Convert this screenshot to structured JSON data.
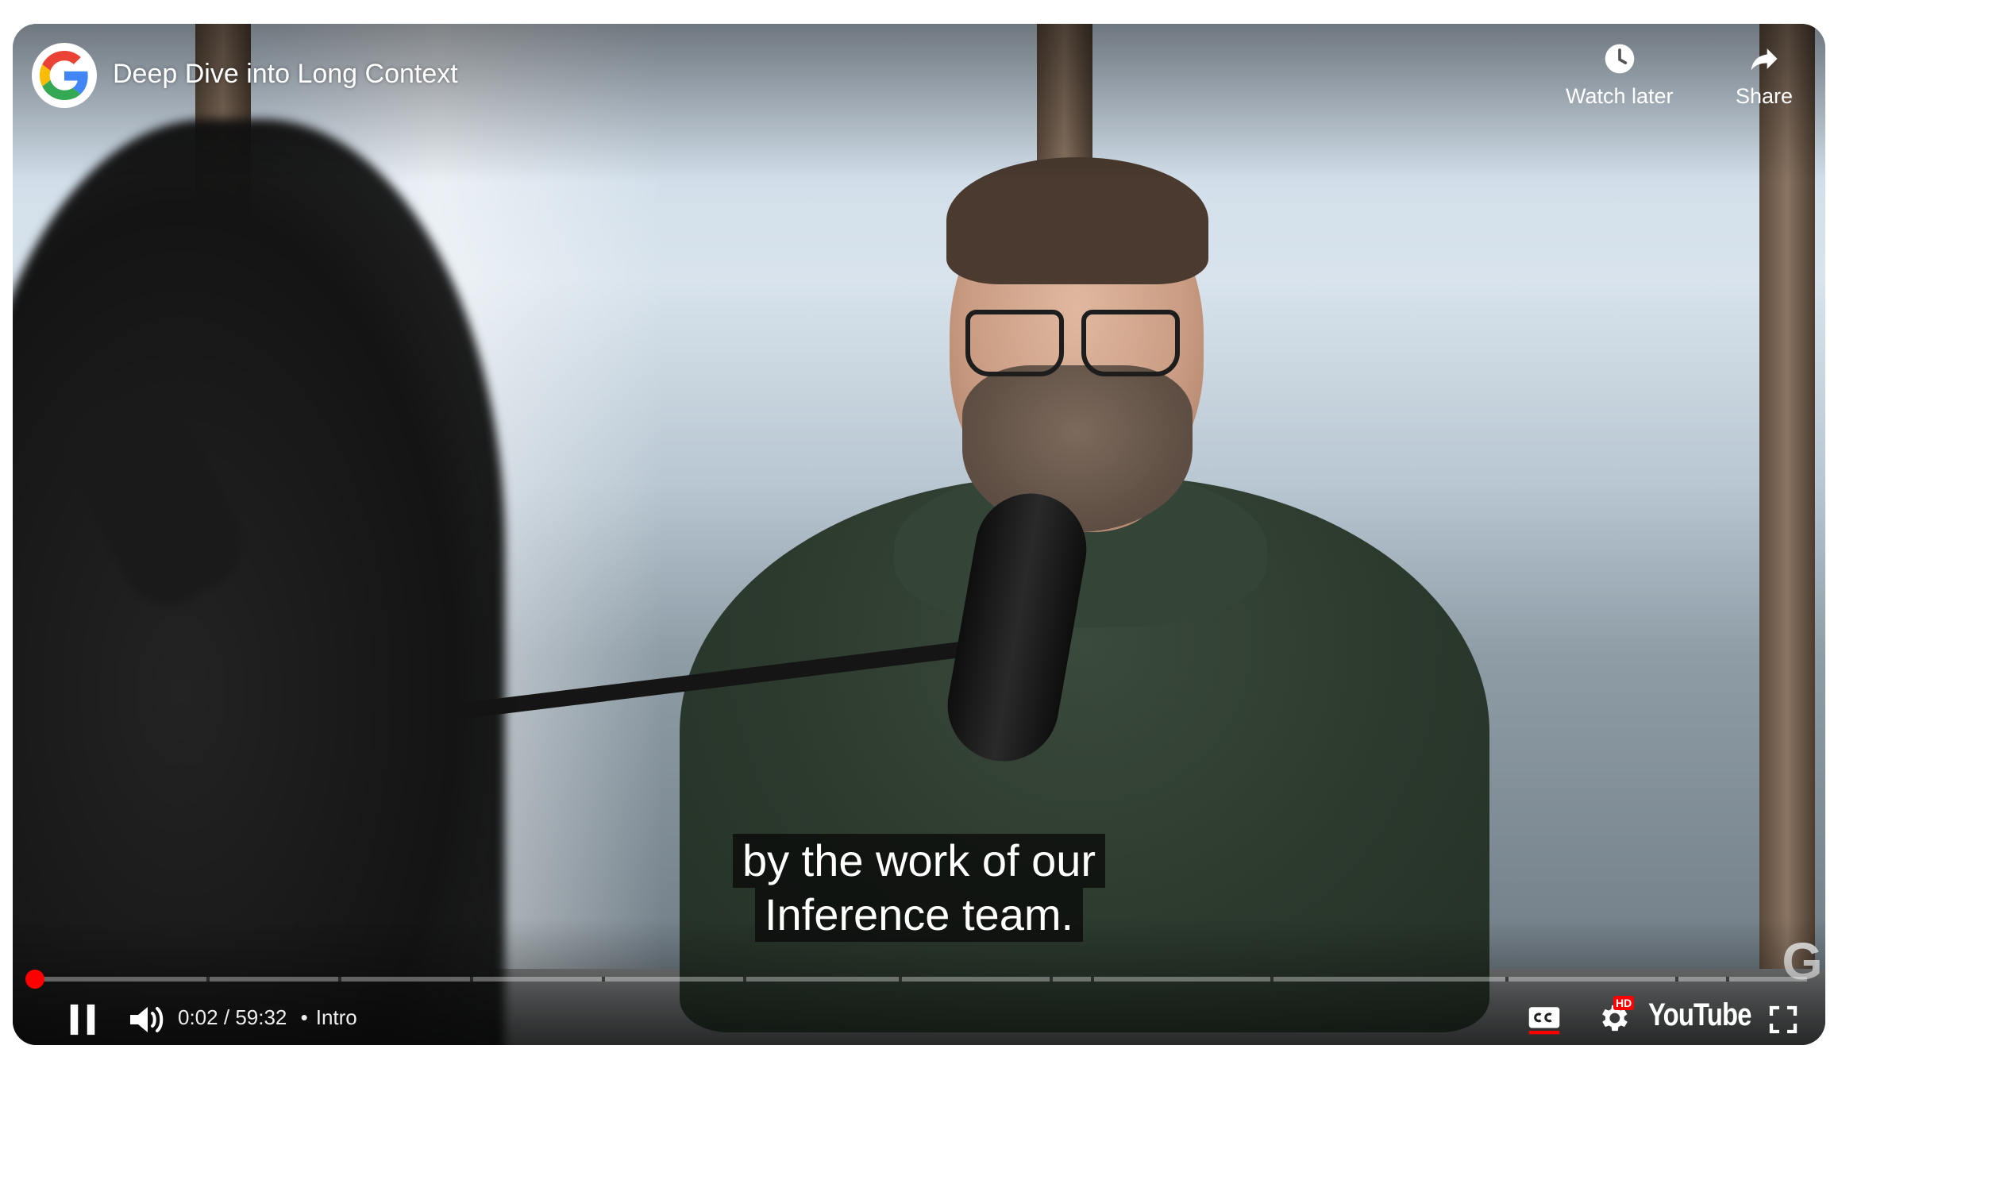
{
  "player": {
    "title": "Deep Dive into Long Context",
    "channel_logo": "google-g-logo",
    "watch_later_label": "Watch later",
    "share_label": "Share",
    "captions": [
      "by the work of our",
      "Inference team."
    ],
    "current_time": "0:02",
    "time_separator": "/",
    "duration": "59:32",
    "chapter_separator": "•",
    "chapter": "Intro",
    "progress_fraction": 0.0006,
    "buffered_fraction": 0.006,
    "youtube_wordmark": "YouTube",
    "hd_badge": "HD",
    "watermark": "G",
    "accent_color": "#ff0000",
    "icons": {
      "watch_later": "clock-icon",
      "share": "share-arrow-icon",
      "play_pause": "pause-icon",
      "volume": "volume-icon",
      "captions": "closed-captions-icon",
      "settings": "gear-icon",
      "fullscreen": "fullscreen-icon"
    }
  }
}
